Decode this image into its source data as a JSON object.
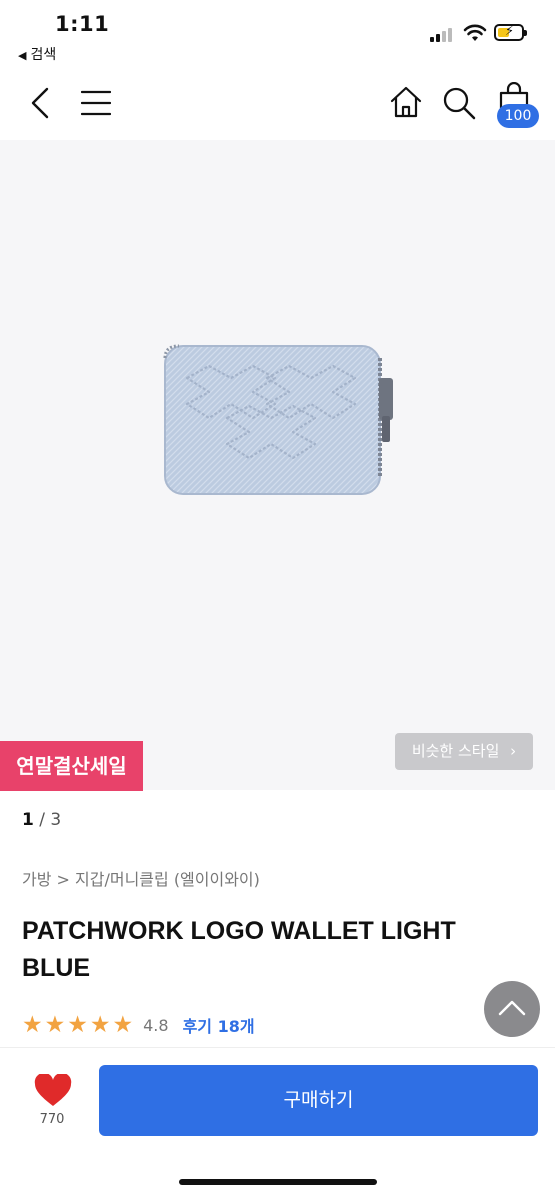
{
  "status_bar": {
    "time": "1:11",
    "back_label": "검색"
  },
  "header": {
    "cart_count": "100"
  },
  "product_image": {
    "alt": "wallet",
    "current_page": "1",
    "total_pages": "3",
    "separator": "/"
  },
  "badges": {
    "sale": "연말결산세일",
    "similar_style": "비슷한 스타일"
  },
  "breadcrumb": "가방 > 지갑/머니클립 (엘이이와이)",
  "product": {
    "title": "PATCHWORK LOGO WALLET LIGHT BLUE",
    "rating": "4.8",
    "rating_value": 4.8,
    "review_link": "후기 18개"
  },
  "bottom_bar": {
    "like_count": "770",
    "buy_label": "구매하기"
  },
  "colors": {
    "accent": "#2f6fe4",
    "sale": "#e8426a",
    "star": "#f2a341",
    "heart": "#e02a2a"
  }
}
